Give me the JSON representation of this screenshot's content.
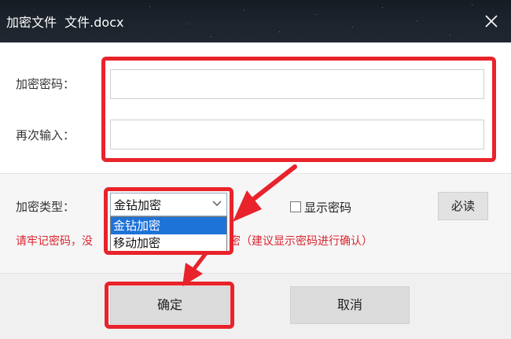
{
  "window": {
    "title": "加密文件  文件.docx",
    "close_icon": "close-icon"
  },
  "form": {
    "password_label": "加密密码：",
    "password_value": "",
    "confirm_label": "再次输入：",
    "confirm_value": "",
    "type_label": "加密类型：",
    "type_selected": "金钻加密",
    "type_options": [
      "金钻加密",
      "移动加密"
    ],
    "show_password_label": "显示密码",
    "show_password_checked": false,
    "must_read_label": "必读",
    "warning_part1": "请牢记密码，没",
    "warning_part2": "密（建议显示密码进行确认）"
  },
  "buttons": {
    "ok_label": "确定",
    "cancel_label": "取消"
  },
  "colors": {
    "highlight": "#e8232b",
    "warning_text": "#d9252f",
    "selected_option": "#1e73d8",
    "titlebar": "#1d242e"
  }
}
